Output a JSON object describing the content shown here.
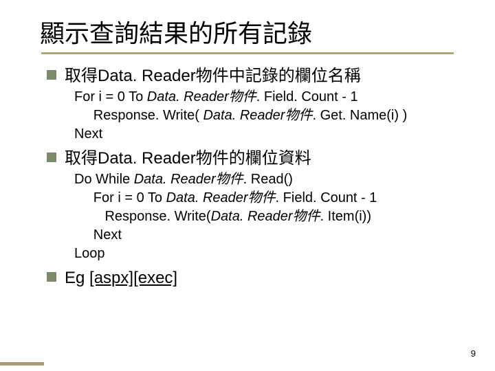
{
  "title": "顯示查詢結果的所有記錄",
  "bullets": [
    {
      "text": "取得Data. Reader物件中記錄的欄位名稱",
      "code": [
        {
          "pre": "For i = 0 To ",
          "it": "Data. Reader物件",
          "post": ". Field. Count - 1"
        },
        {
          "pre": "     Response. Write( ",
          "it": "Data. Reader物件",
          "post": ". Get. Name(i) )"
        },
        {
          "pre": "Next",
          "it": "",
          "post": ""
        }
      ]
    },
    {
      "text": "取得Data. Reader物件的欄位資料",
      "code": [
        {
          "pre": "Do While ",
          "it": "Data. Reader物件",
          "post": ". Read()"
        },
        {
          "pre": "     For i = 0 To ",
          "it": "Data. Reader物件",
          "post": ". Field. Count - 1"
        },
        {
          "pre": "        Response. Write(",
          "it": "Data. Reader物件",
          "post": ". Item(i))"
        },
        {
          "pre": "     Next",
          "it": "",
          "post": ""
        },
        {
          "pre": "Loop",
          "it": "",
          "post": ""
        }
      ]
    }
  ],
  "eg": {
    "prefix": "Eg ",
    "links": [
      "[aspx]",
      "[exec]"
    ]
  },
  "page_number": "9"
}
